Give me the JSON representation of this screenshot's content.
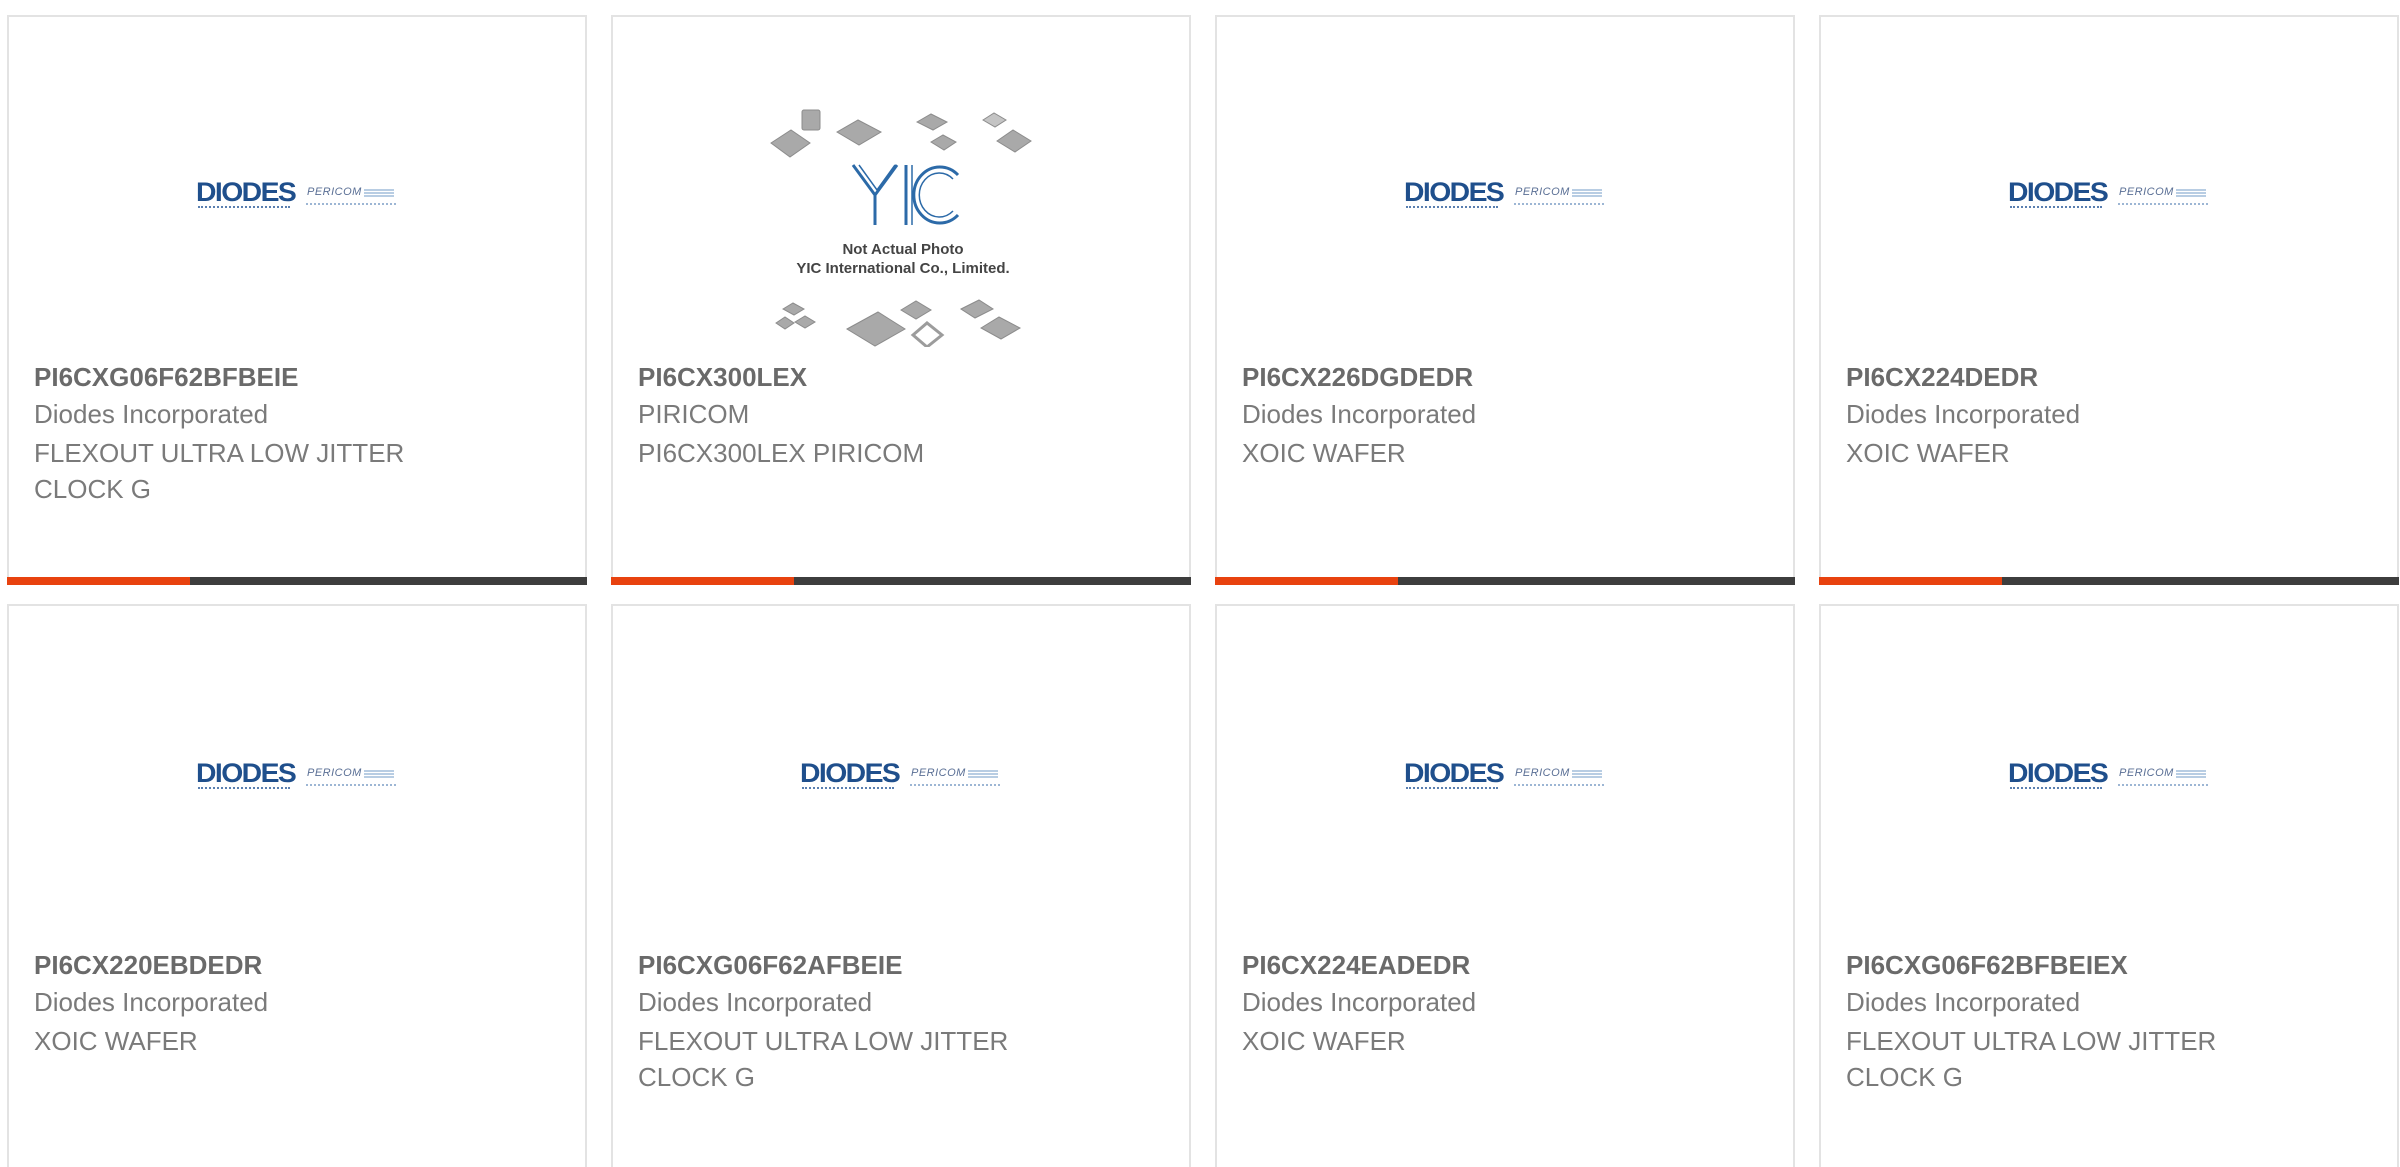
{
  "colors": {
    "accent_orange": "#e8420f",
    "accent_dark": "#3d3d3d",
    "card_border": "#e3e3e3",
    "diodes_blue": "#1f4f8c"
  },
  "logo_text": {
    "diodes": "DIODES",
    "pericom": "PERICOM"
  },
  "yic_photo": {
    "brand": "YIC",
    "line1": "Not Actual Photo",
    "line2": "YIC International Co., Limited."
  },
  "products": [
    {
      "part_number": "PI6CXG06F62BFBEIE",
      "manufacturer": "Diodes Incorporated",
      "description": "FLEXOUT ULTRA LOW JITTER CLOCK G",
      "image": "diodes-pericom-logo"
    },
    {
      "part_number": "PI6CX300LEX",
      "manufacturer": "PIRICOM",
      "description": "PI6CX300LEX PIRICOM",
      "image": "not-actual-photo"
    },
    {
      "part_number": "PI6CX226DGDEDR",
      "manufacturer": "Diodes Incorporated",
      "description": "XOIC WAFER",
      "image": "diodes-pericom-logo"
    },
    {
      "part_number": "PI6CX224DEDR",
      "manufacturer": "Diodes Incorporated",
      "description": "XOIC WAFER",
      "image": "diodes-pericom-logo"
    },
    {
      "part_number": "PI6CX220EBDEDR",
      "manufacturer": "Diodes Incorporated",
      "description": "XOIC WAFER",
      "image": "diodes-pericom-logo"
    },
    {
      "part_number": "PI6CXG06F62AFBEIE",
      "manufacturer": "Diodes Incorporated",
      "description": "FLEXOUT ULTRA LOW JITTER CLOCK G",
      "image": "diodes-pericom-logo"
    },
    {
      "part_number": "PI6CX224EADEDR",
      "manufacturer": "Diodes Incorporated",
      "description": "XOIC WAFER",
      "image": "diodes-pericom-logo"
    },
    {
      "part_number": "PI6CXG06F62BFBEIEX",
      "manufacturer": "Diodes Incorporated",
      "description": "FLEXOUT ULTRA LOW JITTER CLOCK G",
      "image": "diodes-pericom-logo"
    }
  ]
}
